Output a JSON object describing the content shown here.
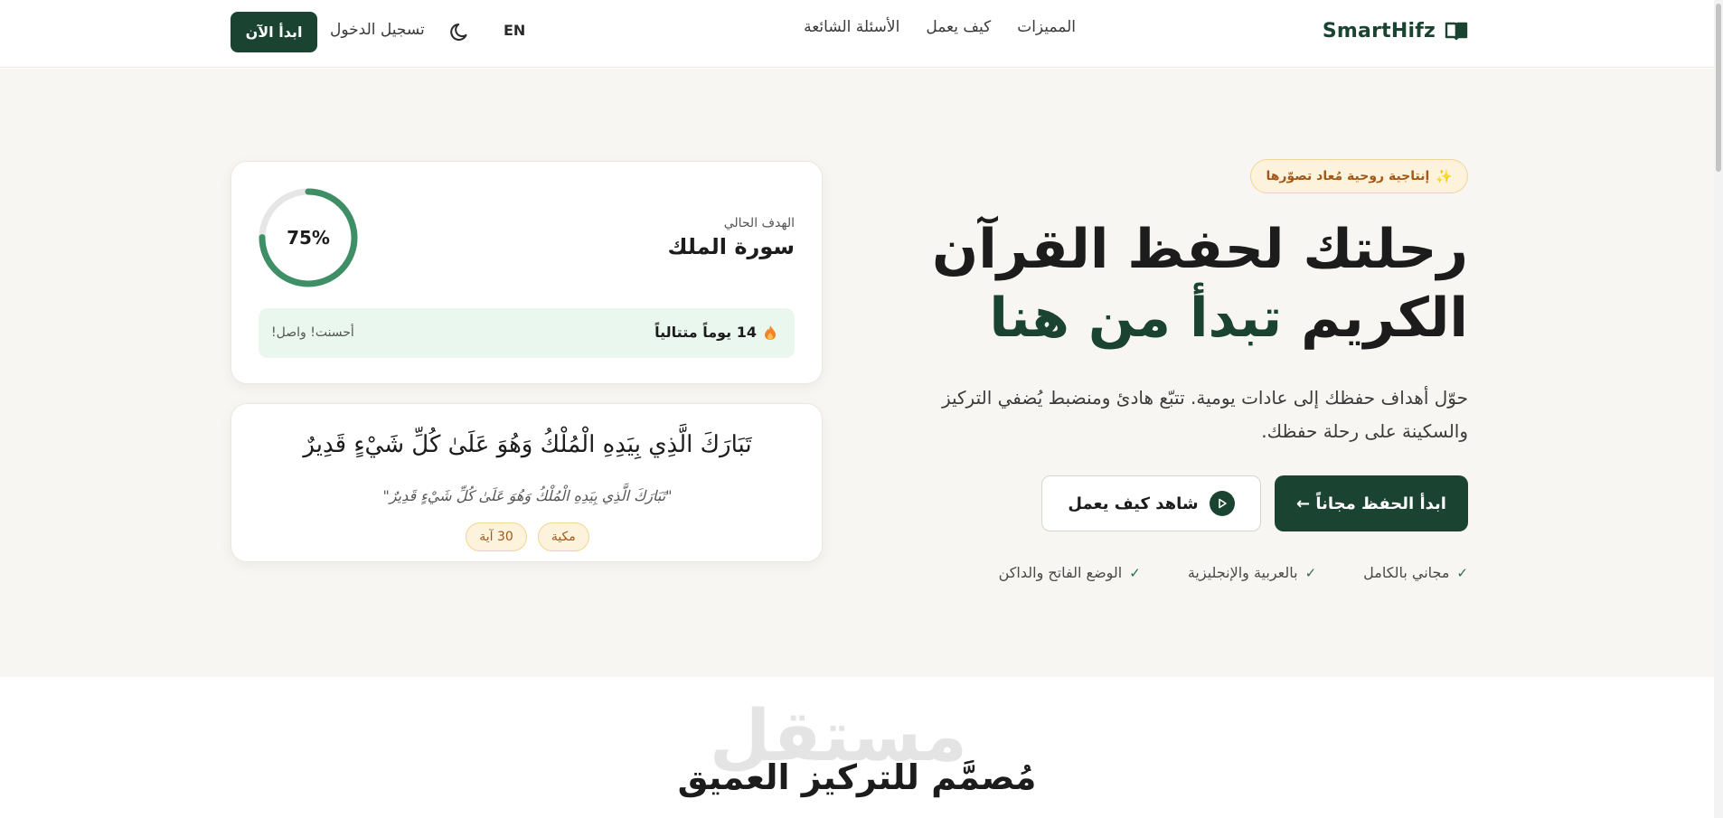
{
  "header": {
    "brand": "SmartHifz",
    "brand_icon": "open-book-icon",
    "nav": [
      "المميزات",
      "كيف يعمل",
      "الأسئلة الشائعة"
    ],
    "lang": "EN",
    "theme_icon": "moon-icon",
    "login": "تسجيل الدخول",
    "start_now": "ابدأ الآن"
  },
  "hero": {
    "badge_icon": "sparkles-icon",
    "badge": "إنتاجية روحية مُعاد تصوّرها",
    "title_line1": "رحلتك لحفظ القرآن",
    "title_line2_a": "الكريم",
    "title_line2_b": "تبدأ من هنا",
    "description": "حوّل أهداف حفظك إلى عادات يومية. تتبّع هادئ ومنضبط يُضفي التركيز والسكينة على رحلة حفظك.",
    "cta_primary": "ابدأ الحفظ مجاناً ←",
    "cta_secondary": "شاهد كيف يعمل",
    "features": [
      "مجاني بالكامل",
      "بالعربية والإنجليزية",
      "الوضع الفاتح والداكن"
    ]
  },
  "goal_card": {
    "label": "الهدف الحالي",
    "title": "سورة الملك",
    "progress": 75,
    "progress_label": "75%",
    "streak": "14 يوماً متتالياً",
    "streak_icon": "fire-icon",
    "streak_note": "أحسنت! واصل!"
  },
  "verse_card": {
    "verse": "تَبَارَكَ الَّذِي بِيَدِهِ الْمُلْكُ وَهُوَ عَلَىٰ كُلِّ شَيْءٍ قَدِيرٌ",
    "quote": "\"تَبَارَكَ الَّذِي بِيَدِهِ الْمُلْكُ وَهُوَ عَلَىٰ كُلِّ شَيْءٍ قَدِيرٌ\"",
    "tags": [
      "مكية",
      "30 آية"
    ]
  },
  "next_section": {
    "title": "مُصمَّم للتركيز العميق"
  },
  "watermark": "مستقل",
  "colors": {
    "primary": "#1b4332",
    "accent_green": "#3f8f66",
    "ring_track": "#e6e6e6",
    "badge_bg": "#fdf3dc",
    "badge_text": "#a2581a",
    "hero_bg": "#f8f6f2",
    "streak_bg": "#eaf7ee"
  }
}
